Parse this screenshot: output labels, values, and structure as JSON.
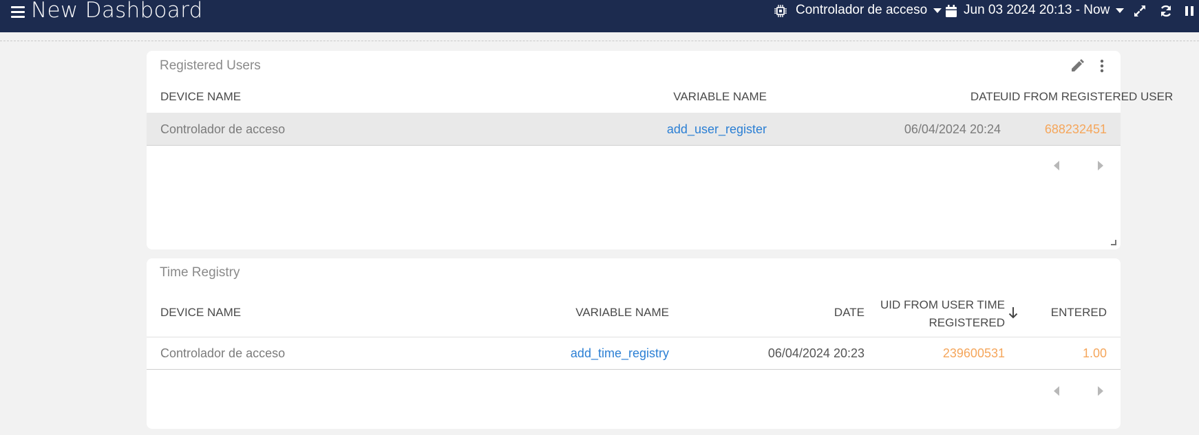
{
  "header": {
    "title": "New Dashboard",
    "device_selector": "Controlador de acceso",
    "date_range": "Jun 03 2024 20:13 - Now"
  },
  "widget1": {
    "title": "Registered Users",
    "columns": [
      "DEVICE NAME",
      "VARIABLE NAME",
      "DATE",
      "UID FROM REGISTERED USER"
    ],
    "rows": [
      [
        "Controlador de acceso",
        "add_user_register",
        "06/04/2024 20:24",
        "688232451"
      ]
    ]
  },
  "widget2": {
    "title": "Time Registry",
    "columns": [
      "DEVICE NAME",
      "VARIABLE NAME",
      "DATE",
      "UID FROM USER TIME",
      "REGISTERED",
      "ENTERED"
    ],
    "rows": [
      [
        "Controlador de acceso",
        "add_time_registry",
        "06/04/2024 20:23",
        "239600531",
        "1.00"
      ]
    ]
  },
  "colors": {
    "topbar": "#1c2b4f",
    "link": "#2b7fd4",
    "value": "#f5a65b"
  },
  "icons": [
    "menu-icon",
    "chip-icon",
    "calendar-icon",
    "expand-icon",
    "refresh-icon",
    "pause-icon",
    "pencil-icon",
    "more-vertical-icon",
    "sort-arrow-down-icon",
    "chevron-left-icon",
    "chevron-right-icon",
    "resize-handle-icon"
  ]
}
